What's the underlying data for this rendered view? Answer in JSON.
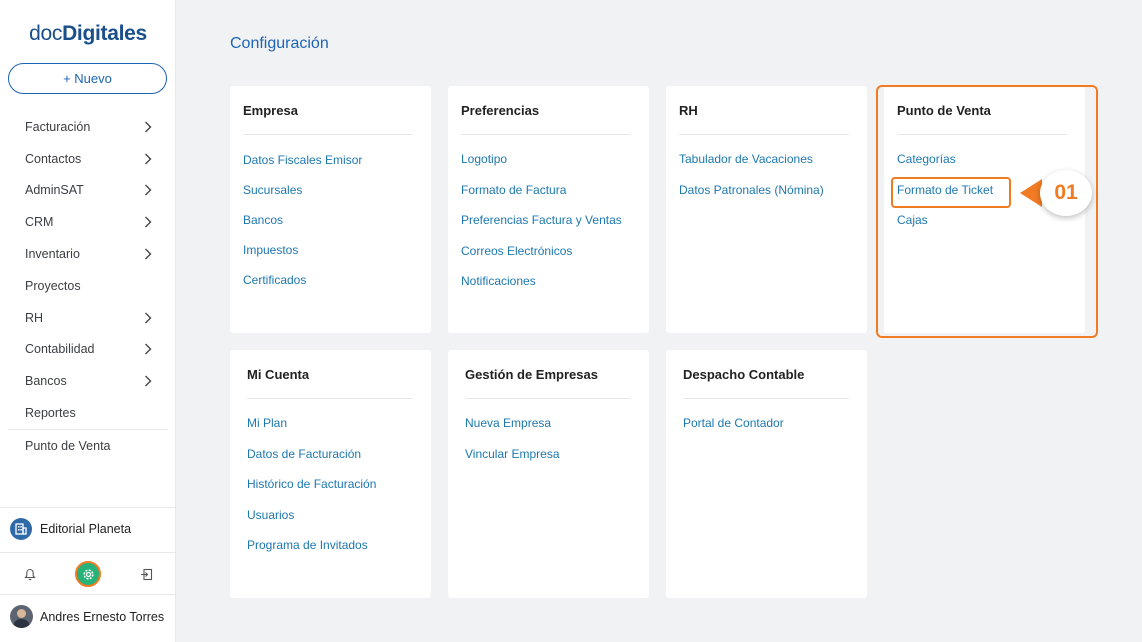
{
  "brand": {
    "prefix": "doc",
    "name": "Digitales"
  },
  "sidebar": {
    "new_button": "+ Nuevo",
    "items": [
      {
        "label": "Facturación",
        "has_children": true
      },
      {
        "label": "Contactos",
        "has_children": true
      },
      {
        "label": "AdminSAT",
        "has_children": true
      },
      {
        "label": "CRM",
        "has_children": true
      },
      {
        "label": "Inventario",
        "has_children": true
      },
      {
        "label": "Proyectos",
        "has_children": false
      },
      {
        "label": "RH",
        "has_children": true
      },
      {
        "label": "Contabilidad",
        "has_children": true
      },
      {
        "label": "Bancos",
        "has_children": true
      },
      {
        "label": "Reportes",
        "has_children": false
      },
      {
        "label": "Punto de Venta",
        "has_children": false
      }
    ],
    "company": "Editorial Planeta",
    "user": "Andres Ernesto Torres",
    "bottom_icons": [
      "bell-icon",
      "gear-icon",
      "logout-icon"
    ]
  },
  "main": {
    "title": "Configuración",
    "cards": [
      {
        "title": "Empresa",
        "links": [
          "Datos Fiscales Emisor",
          "Sucursales",
          "Bancos",
          "Impuestos",
          "Certificados"
        ]
      },
      {
        "title": "Preferencias",
        "links": [
          "Logotipo",
          "Formato de Factura",
          "Preferencias Factura y Ventas",
          "Correos Electrónicos",
          "Notificaciones"
        ]
      },
      {
        "title": "RH",
        "links": [
          "Tabulador de Vacaciones",
          "Datos Patronales (Nómina)"
        ]
      },
      {
        "title": "Punto de Venta",
        "links": [
          "Categorías",
          "Formato de Ticket",
          "Cajas"
        ]
      },
      {
        "title": "Mi Cuenta",
        "links": [
          "Mi Plan",
          "Datos de Facturación",
          "Histórico de Facturación",
          "Usuarios",
          "Programa de Invitados"
        ]
      },
      {
        "title": "Gestión de Empresas",
        "links": [
          "Nueva Empresa",
          "Vincular Empresa"
        ]
      },
      {
        "title": "Despacho Contable",
        "links": [
          "Portal de Contador"
        ]
      }
    ]
  },
  "annotation": {
    "step": "01",
    "color": "#f07b22"
  },
  "colors": {
    "accent": "#1d64b5",
    "link": "#1d78b0",
    "highlight": "#f07b22",
    "active_gear": "#27b27a"
  }
}
